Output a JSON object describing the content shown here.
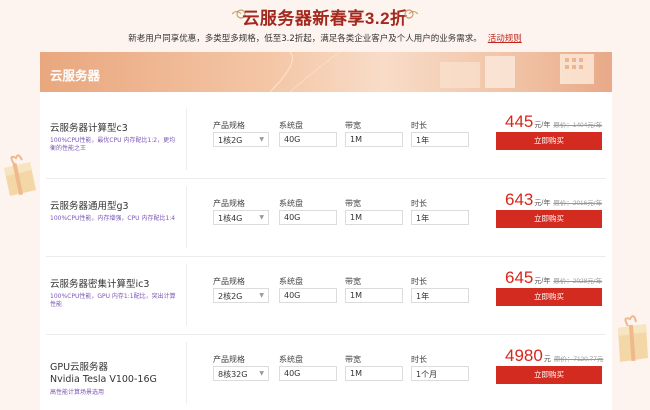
{
  "header": {
    "title": "云服务器新春享3.2折",
    "subtitle": "新老用户同享优惠，多类型多规格，低至3.2折起，满足各类企业客户及个人用户的业务需求。",
    "rules_link": "活动规则"
  },
  "banner": {
    "title": "云服务器"
  },
  "labels": {
    "spec": "产品规格",
    "disk": "系统盘",
    "bandwidth": "带宽",
    "duration": "时长",
    "buy": "立即购买",
    "currency_unit": "元/年"
  },
  "products": [
    {
      "name": "云服务器计算型c3",
      "desc": "100%CPU性能，最优CPU 内存配比1:2，更均衡的性能之王",
      "spec": "1核2G",
      "disk": "40G",
      "bandwidth": "1M",
      "duration": "1年",
      "price": "445",
      "unit": "元/年",
      "original": "原价：1404元/年"
    },
    {
      "name": "云服务器通用型g3",
      "desc": "100%CPU性能，内存增强，CPU 内存配比1:4",
      "spec": "1核4G",
      "disk": "40G",
      "bandwidth": "1M",
      "duration": "1年",
      "price": "643",
      "unit": "元/年",
      "original": "原价：2016元/年"
    },
    {
      "name": "云服务器密集计算型ic3",
      "desc": "100%CPU性能，GPU 内存1:1配比，突出计算性能",
      "spec": "2核2G",
      "disk": "40G",
      "bandwidth": "1M",
      "duration": "1年",
      "price": "645",
      "unit": "元/年",
      "original": "原价：2028元/年"
    },
    {
      "name": "GPU云服务器\nNvidia Tesla V100-16G",
      "desc": "高性能计算场景选用",
      "spec": "8核32G",
      "disk": "40G",
      "bandwidth": "1M",
      "duration": "1个月",
      "price": "4980",
      "unit": "元",
      "original": "原价：7120.77元"
    }
  ],
  "colors": {
    "accent": "#d32b1f",
    "title": "#a3281d",
    "page_bg": "#fdf4ef"
  },
  "icons": [
    "ornament-left-icon",
    "ornament-right-icon",
    "gift-box-icon",
    "chevron-down-icon"
  ]
}
